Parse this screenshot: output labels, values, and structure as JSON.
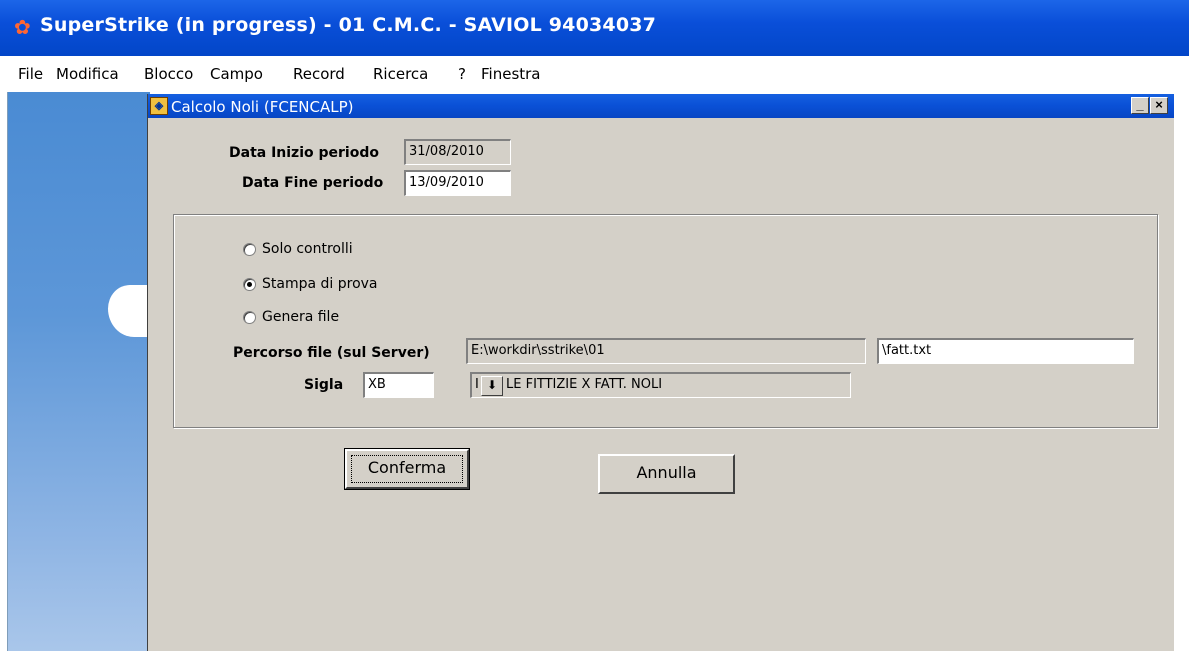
{
  "window": {
    "title": "SuperStrike (in progress) - 01 C.M.C. - SAVIOL 94034037",
    "icon": "superstrike-app-icon"
  },
  "menu": {
    "items": [
      "File",
      "Modifica",
      "Blocco",
      "Campo",
      "Record",
      "Ricerca",
      "?",
      "Finestra"
    ]
  },
  "inner_window": {
    "title": "Calcolo Noli (FCENCALP)",
    "minimize_glyph": "_",
    "close_glyph": "×"
  },
  "form": {
    "data_inizio_label": "Data Inizio periodo",
    "data_inizio_value": "31/08/2010",
    "data_fine_label": "Data Fine periodo",
    "data_fine_value": "13/09/2010",
    "options": [
      {
        "label": "Solo controlli",
        "checked": false
      },
      {
        "label": "Stampa di prova",
        "checked": true
      },
      {
        "label": "Genera file",
        "checked": false
      }
    ],
    "percorso_label": "Percorso file (sul Server)",
    "percorso_value": "E:\\workdir\\sstrike\\01",
    "file_name_value": "\\fatt.txt",
    "sigla_label": "Sigla",
    "sigla_value": "XB",
    "sigla_code_prefix": "I",
    "sigla_dropdown_glyph": "⬇",
    "sigla_description": "LE FITTIZIE X FATT. NOLI"
  },
  "buttons": {
    "confirm": "Conferma",
    "cancel": "Annulla"
  }
}
